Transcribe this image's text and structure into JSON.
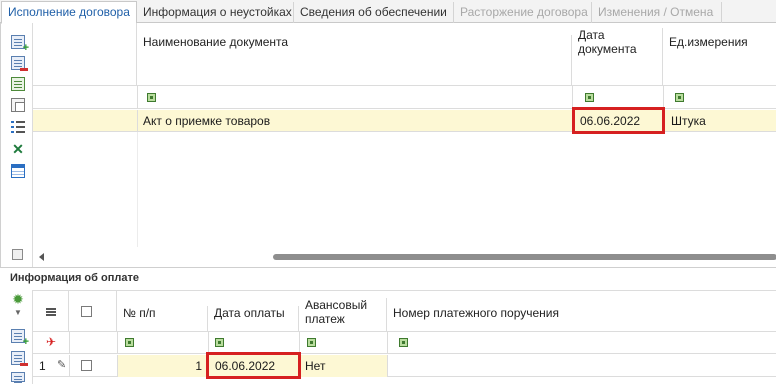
{
  "tabs": [
    {
      "label": "Исполнение договора",
      "state": "active"
    },
    {
      "label": "Информация о неустойках",
      "state": "normal"
    },
    {
      "label": "Сведения об обеспечении",
      "state": "normal"
    },
    {
      "label": "Расторжение договора",
      "state": "disabled"
    },
    {
      "label": "Изменения / Отмена",
      "state": "disabled"
    }
  ],
  "docs_grid": {
    "columns": {
      "name": "Наименование документа",
      "date_line1": "Дата",
      "date_line2": "документа",
      "unit": "Ед.измерения"
    },
    "rows": [
      {
        "name": "Акт о приемке товаров",
        "date": "06.06.2022",
        "unit": "Штука"
      }
    ]
  },
  "payment_section": {
    "title": "Информация об оплате",
    "columns": {
      "num": "№ п/п",
      "pay_date": "Дата оплаты",
      "advance_line1": "Авансовый",
      "advance_line2": "платеж",
      "order_no": "Номер платежного поручения"
    },
    "rows": [
      {
        "index": "1",
        "num": "1",
        "pay_date": "06.06.2022",
        "advance": "Нет",
        "order_no": ""
      }
    ]
  },
  "colors": {
    "selected_row": "#fdf8d4",
    "highlight_border": "#d62020",
    "active_tab_text": "#1f5fa8",
    "filter_icon": "#b9dd9e"
  },
  "icons": {
    "docs_toolbar": [
      "add-row-icon",
      "delete-row-icon",
      "insert-row-icon",
      "copy-icon",
      "list-settings-icon",
      "excel-export-icon",
      "table-settings-icon",
      "column-chooser-icon"
    ],
    "payment_toolbar": [
      "settings-gear-icon",
      "add-row-icon",
      "delete-row-icon"
    ]
  }
}
